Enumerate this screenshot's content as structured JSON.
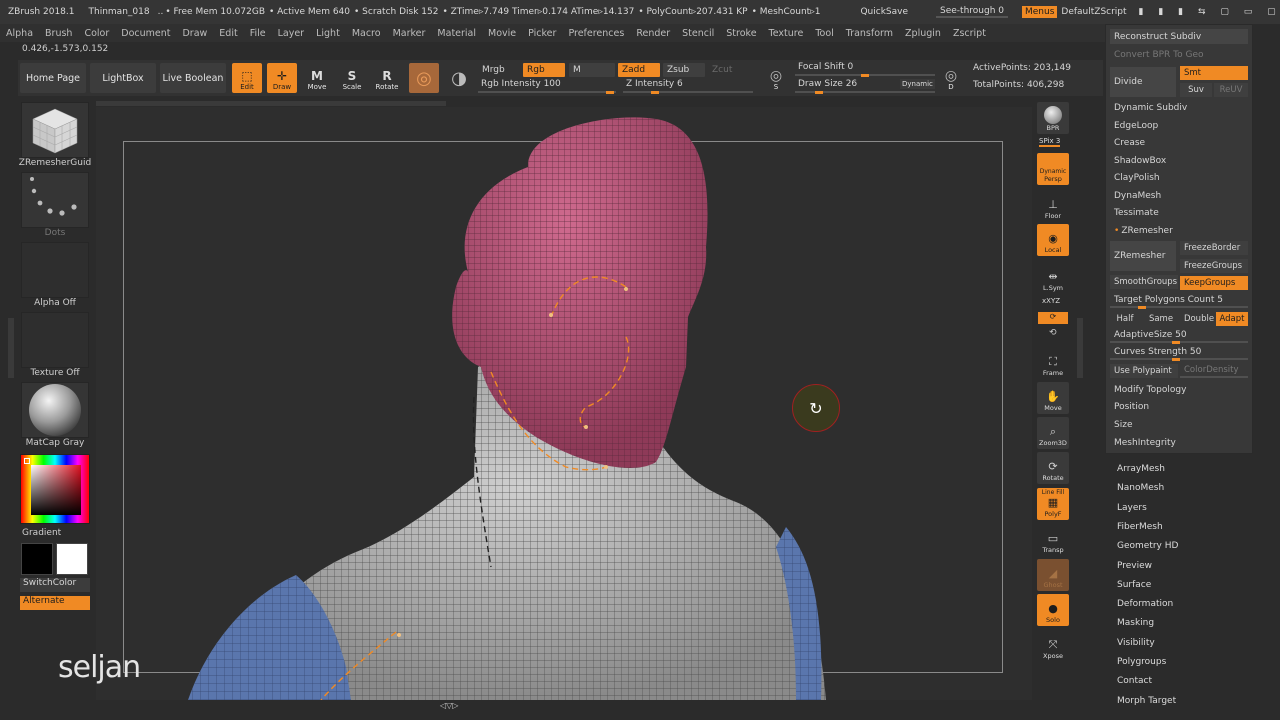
{
  "titlebar": {
    "app": "ZBrush 2018.1",
    "doc": "Thinman_018",
    "dots": "..",
    "free_mem": "• Free Mem 10.072GB",
    "active_mem": "• Active Mem 640",
    "scratch": "• Scratch Disk 152",
    "ztime": "• ZTime▹7.749 Timer▹0.174 ATime▹14.137",
    "polycount": "• PolyCount▹207.431 KP",
    "meshcount": "• MeshCount▹1",
    "quicksave": "QuickSave",
    "seethrough": "See-through  0",
    "menus": "Menus",
    "script": "DefaultZScript"
  },
  "menubar": [
    "Alpha",
    "Brush",
    "Color",
    "Document",
    "Draw",
    "Edit",
    "File",
    "Layer",
    "Light",
    "Macro",
    "Marker",
    "Material",
    "Movie",
    "Picker",
    "Preferences",
    "Render",
    "Stencil",
    "Stroke",
    "Texture",
    "Tool",
    "Transform",
    "Zplugin",
    "Zscript"
  ],
  "coords": "0.426,-1.573,0.152",
  "toolbar": {
    "home": "Home Page",
    "lightbox": "LightBox",
    "liveboolean": "Live Boolean",
    "edit": "Edit",
    "draw": "Draw",
    "move": "Move",
    "scale": "Scale",
    "rotate": "Rotate",
    "mrgb": "Mrgb",
    "rgb": "Rgb",
    "m": "M",
    "rgb_intensity": "Rgb Intensity 100",
    "zadd": "Zadd",
    "zsub": "Zsub",
    "zcut": "Zcut",
    "z_intensity": "Z Intensity 6",
    "focal_shift": "Focal Shift 0",
    "draw_size": "Draw Size 26",
    "dynamic": "Dynamic",
    "active_points": "ActivePoints: 203,149",
    "total_points": "TotalPoints: 406,298"
  },
  "leftshelf": {
    "brush": "ZRemesherGuid",
    "stroke": "Dots",
    "alpha": "Alpha Off",
    "texture": "Texture Off",
    "material": "MatCap Gray",
    "gradient": "Gradient",
    "switchcolor": "SwitchColor",
    "alternate": "Alternate"
  },
  "rightshelf": {
    "bpr": "BPR",
    "spix": "SPix 3",
    "dynamic": "Dynamic",
    "persp": "Persp",
    "floor": "Floor",
    "local": "Local",
    "lsym": "L.Sym",
    "xyz": "xXYZ",
    "frame": "Frame",
    "move": "Move",
    "zoom3d": "Zoom3D",
    "rotate": "Rotate",
    "linefill": "Line Fill",
    "polyf": "PolyF",
    "transp": "Transp",
    "ghost": "Ghost",
    "solo": "Solo",
    "xpose": "Xpose"
  },
  "rpanel": {
    "reconstruct": "Reconstruct Subdiv",
    "convert_bpr": "Convert BPR To Geo",
    "divide": "Divide",
    "smt": "Smt",
    "suv": "Suv",
    "reuv": "ReUV",
    "dynamic_subdiv": "Dynamic Subdiv",
    "edgeloop": "EdgeLoop",
    "crease": "Crease",
    "shadowbox": "ShadowBox",
    "claypolish": "ClayPolish",
    "dynamesh": "DynaMesh",
    "tessimate": "Tessimate",
    "zremesher_head": "ZRemesher",
    "zremesher_btn": "ZRemesher",
    "freezeborder": "FreezeBorder",
    "freezegroups": "FreezeGroups",
    "smoothgroups": "SmoothGroups",
    "keepgroups": "KeepGroups",
    "target_polys": "Target Polygons Count 5",
    "half": "Half",
    "same": "Same",
    "double": "Double",
    "adapt": "Adapt",
    "adaptivesize": "AdaptiveSize 50",
    "curves_strength": "Curves Strength 50",
    "use_polypaint": "Use Polypaint",
    "colordensity": "ColorDensity",
    "modify_topology": "Modify Topology",
    "position": "Position",
    "size": "Size",
    "meshintegrity": "MeshIntegrity"
  },
  "rlist": [
    "ArrayMesh",
    "NanoMesh",
    "Layers",
    "FiberMesh",
    "Geometry HD",
    "Preview",
    "Surface",
    "Deformation",
    "Masking",
    "Visibility",
    "Polygroups",
    "Contact",
    "Morph Target"
  ],
  "watermark": "seljan",
  "colors": {
    "accent": "#f08a24",
    "head": "#b34f72",
    "shoulder": "#5a76ad",
    "body": "#a9a9a9"
  }
}
